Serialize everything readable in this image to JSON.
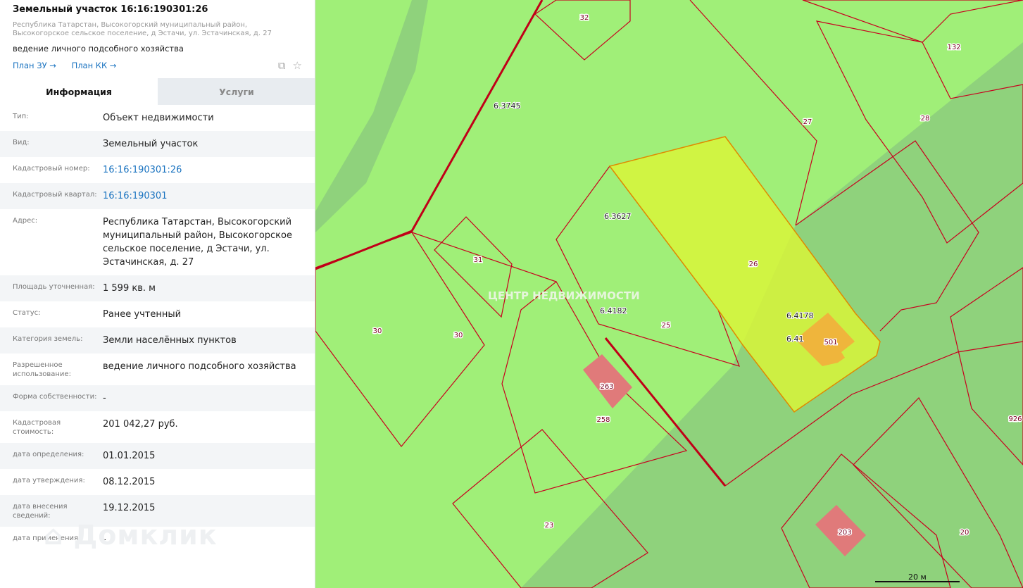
{
  "header": {
    "title": "Земельный участок 16:16:190301:26",
    "address": "Республика Татарстан, Высокогорский муниципальный район, Высокогорское сельское поселение, д Эстачи, ул. Эстачинская, д. 27",
    "usage": "ведение личного подсобного хозяйства",
    "link_plan_zu": "План ЗУ →",
    "link_plan_kk": "План КК →"
  },
  "icons": [
    "search-document-icon",
    "star-icon"
  ],
  "tabs": [
    {
      "label": "Информация",
      "active": true
    },
    {
      "label": "Услуги",
      "active": false
    }
  ],
  "rows": [
    {
      "label": "Тип:",
      "value": "Объект недвижимости"
    },
    {
      "label": "Вид:",
      "value": "Земельный участок"
    },
    {
      "label": "Кадастровый номер:",
      "value": "16:16:190301:26"
    },
    {
      "label": "Кадастровый квартал:",
      "value": "16:16:190301"
    },
    {
      "label": "Адрес:",
      "value": "Республика Татарстан, Высокогорский муниципальный район, Высокогорское сельское поселение, д Эстачи, ул. Эстачинская, д. 27"
    },
    {
      "label": "Площадь уточненная:",
      "value": "1 599 кв. м"
    },
    {
      "label": "Статус:",
      "value": "Ранее учтенный"
    },
    {
      "label": "Категория земель:",
      "value": "Земли населённых пунктов"
    },
    {
      "label": "Разрешенное использование:",
      "value": "ведение личного подсобного хозяйства"
    },
    {
      "label": "Форма собственности:",
      "value": "-"
    },
    {
      "label": "Кадастровая стоимость:",
      "value": "201 042,27 руб."
    },
    {
      "label": "дата определения:",
      "value": "01.01.2015"
    },
    {
      "label": "дата утверждения:",
      "value": "08.12.2015"
    },
    {
      "label": "дата внесения сведений:",
      "value": "19.12.2015"
    },
    {
      "label": "дата применения:",
      "value": "-"
    }
  ],
  "watermark": "Домклик",
  "map": {
    "watermark": "ЦЕНТР НЕДВИЖИМОСТИ",
    "parcel_labels": [
      "32",
      "132",
      "27",
      "28",
      "26",
      "31",
      "25",
      "30",
      "30",
      "258",
      "23",
      "20",
      "926",
      "501",
      "263",
      "203"
    ],
    "quarter_labels": [
      "6.3745",
      "6.3627",
      "6.4182",
      "6.4178",
      "6.41"
    ],
    "scale": "20 м",
    "colors": {
      "land": "#a0ef78",
      "zone": "#8fd27c",
      "selected": "#d8f53a",
      "border": "#c8001e",
      "building": "#e07a7a"
    }
  }
}
